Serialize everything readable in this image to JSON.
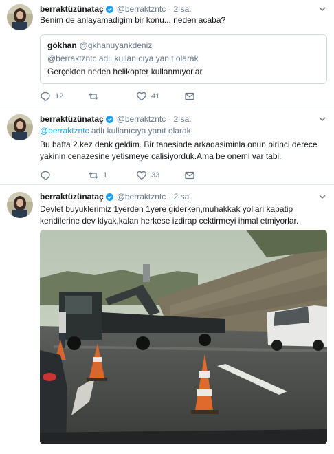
{
  "tweets": [
    {
      "name": "berraktüzünataç",
      "handle": "@berraktzntc",
      "time": "· 2 sa.",
      "text": "Benim de anlayamadigim bir konu... neden acaba?",
      "quote": {
        "name": "gökhan",
        "handle": "@gkhanuyankdeniz",
        "reply_context": "@berraktzntc adlı kullanıcıya yanıt olarak",
        "text": "Gerçekten neden helikopter kullanmıyorlar"
      },
      "actions": {
        "replies": "12",
        "retweets": "",
        "likes": "41"
      }
    },
    {
      "name": "berraktüzünataç",
      "handle": "@berraktzntc",
      "time": "· 2 sa.",
      "reply_handle": "@berraktzntc",
      "reply_suffix": " adlı kullanıcıya yanıt olarak",
      "text_line1": "Bu hafta 2.kez denk geldim. Bir tanesinde arkadasiminla onun birinci derece",
      "text_line2": "yakinin cenazesine yetismeye calisiyorduk.Ama be onemi var tabi.",
      "actions": {
        "replies": "",
        "retweets": "1",
        "likes": "33"
      }
    },
    {
      "name": "berraktüzünataç",
      "handle": "@berraktzntc",
      "time": "· 2 sa.",
      "text_line1": "Devlet buyuklerimiz 1yerden 1yere giderken,muhakkak yollari kapatip",
      "text_line2": "kendilerine dev kiyak,kalan herkese izdirap cektirmeyi ihmal etmiyorlar.",
      "media": "photo"
    }
  ],
  "icons": {
    "verified": "verified-badge-icon",
    "reply": "reply-icon",
    "retweet": "retweet-icon",
    "like": "heart-icon",
    "dm": "envelope-icon",
    "more": "chevron-down-icon"
  },
  "colors": {
    "accent": "#1da1f2",
    "muted": "#657786",
    "text": "#14171a",
    "border": "#e1e8ed"
  }
}
